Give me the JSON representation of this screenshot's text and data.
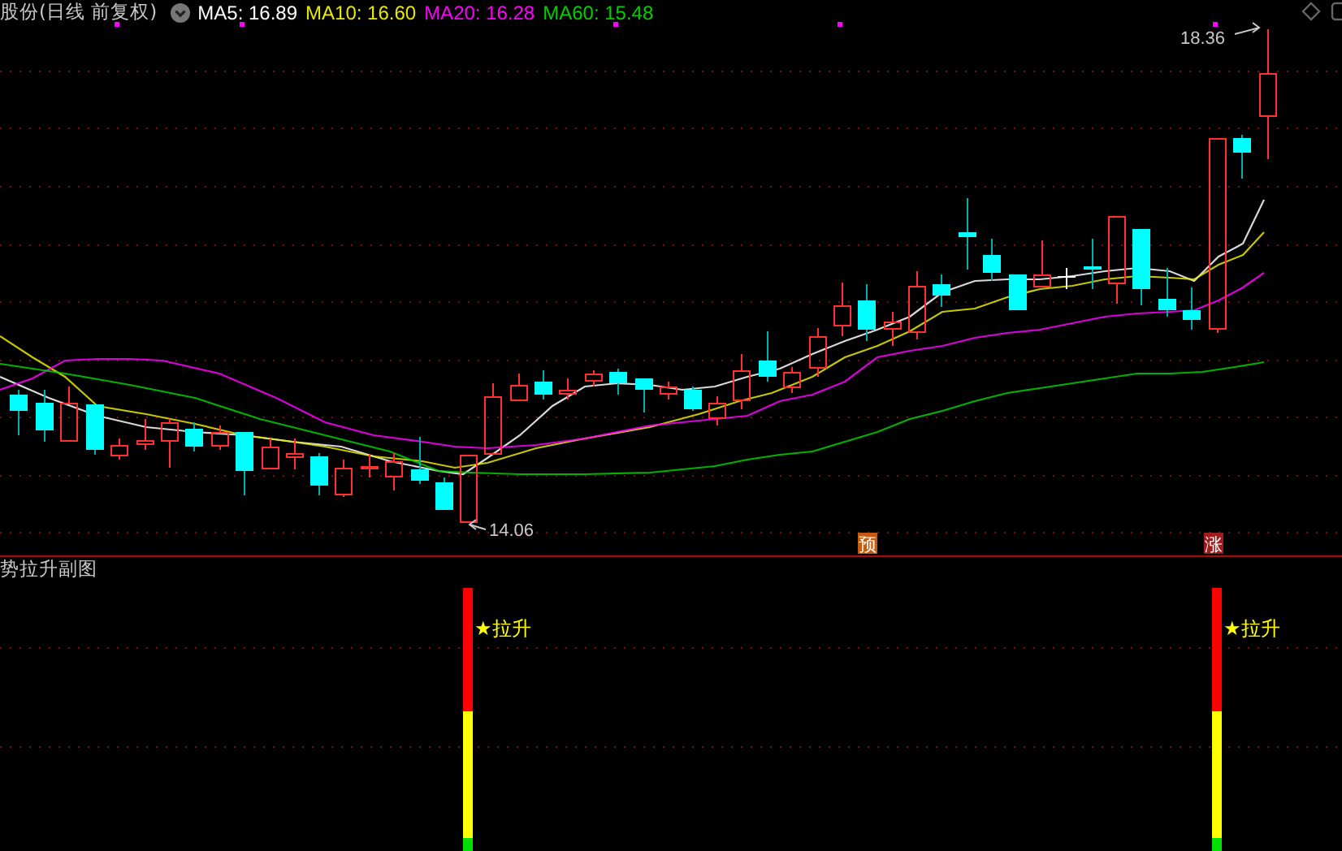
{
  "header": {
    "title": "股份(日线 前复权)",
    "ma_legend": [
      {
        "label": "MA5: 16.89",
        "color": "#ffffff"
      },
      {
        "label": "MA10: 16.60",
        "color": "#e8e800"
      },
      {
        "label": "MA20: 16.28",
        "color": "#ff00ff"
      },
      {
        "label": "MA60: 15.48",
        "color": "#00d000"
      }
    ]
  },
  "price_annotations": [
    {
      "kind": "high",
      "text": "18.36"
    },
    {
      "kind": "low",
      "text": "14.06"
    }
  ],
  "signal_badges": [
    {
      "text": "预",
      "color": "#c85a10"
    },
    {
      "text": "涨",
      "color": "#a01c1c"
    }
  ],
  "indicator_panel": {
    "title": "势拉升副图",
    "signals": [
      {
        "label": "★拉升"
      },
      {
        "label": "★拉升"
      }
    ]
  }
}
